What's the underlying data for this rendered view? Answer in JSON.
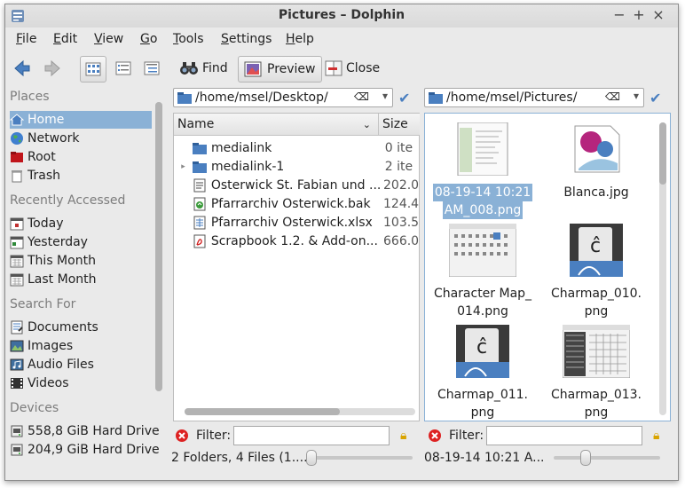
{
  "window": {
    "title": "Pictures – Dolphin"
  },
  "menu": [
    {
      "label": "File",
      "u": "F",
      "rest": "ile"
    },
    {
      "label": "Edit",
      "u": "E",
      "rest": "dit"
    },
    {
      "label": "View",
      "u": "V",
      "rest": "iew"
    },
    {
      "label": "Go",
      "u": "G",
      "rest": "o"
    },
    {
      "label": "Tools",
      "u": "T",
      "rest": "ools"
    },
    {
      "label": "Settings",
      "u": "S",
      "rest": "ettings"
    },
    {
      "label": "Help",
      "u": "H",
      "rest": "elp"
    }
  ],
  "toolbar": {
    "find": "Find",
    "preview": "Preview",
    "close": "Close"
  },
  "places": {
    "heading": "Places",
    "items": [
      "Home",
      "Network",
      "Root",
      "Trash"
    ],
    "selected": "Home"
  },
  "recent": {
    "heading": "Recently Accessed",
    "items": [
      "Today",
      "Yesterday",
      "This Month",
      "Last Month"
    ]
  },
  "search": {
    "heading": "Search For",
    "items": [
      "Documents",
      "Images",
      "Audio Files",
      "Videos"
    ]
  },
  "devices": {
    "heading": "Devices",
    "items": [
      "558,8 GiB Hard Drive",
      "204,9 GiB Hard Drive"
    ]
  },
  "left_pane": {
    "path": "/home/msel/Desktop/",
    "columns": {
      "name": "Name",
      "size": "Size"
    },
    "rows": [
      {
        "name": "medialink",
        "size": "0 ite",
        "type": "folder"
      },
      {
        "name": "medialink-1",
        "size": "2 ite",
        "type": "folder"
      },
      {
        "name": "Osterwick St. Fabian und ...",
        "size": "202.0",
        "type": "doc"
      },
      {
        "name": "Pfarrarchiv Osterwick.bak",
        "size": "124.4",
        "type": "bak"
      },
      {
        "name": "Pfarrarchiv Osterwick.xlsx",
        "size": "103.5",
        "type": "xlsx"
      },
      {
        "name": "Scrapbook 1.2. & Add-on...",
        "size": "666.0",
        "type": "pdf"
      }
    ],
    "filter_label": "Filter:",
    "status": "2 Folders, 4 Files (1...."
  },
  "right_pane": {
    "path": "/home/msel/Pictures/",
    "items": [
      {
        "line1": "08-19-14 10:21",
        "line2": "AM_008.png",
        "selected": true
      },
      {
        "line1": "Blanca.jpg",
        "line2": ""
      },
      {
        "line1": "Character Map_",
        "line2": "014.png"
      },
      {
        "line1": "Charmap_010.",
        "line2": "png"
      },
      {
        "line1": "Charmap_011.",
        "line2": "png"
      },
      {
        "line1": "Charmap_013.",
        "line2": "png"
      }
    ],
    "filter_label": "Filter:",
    "status": "08-19-14 10:21 A..."
  }
}
